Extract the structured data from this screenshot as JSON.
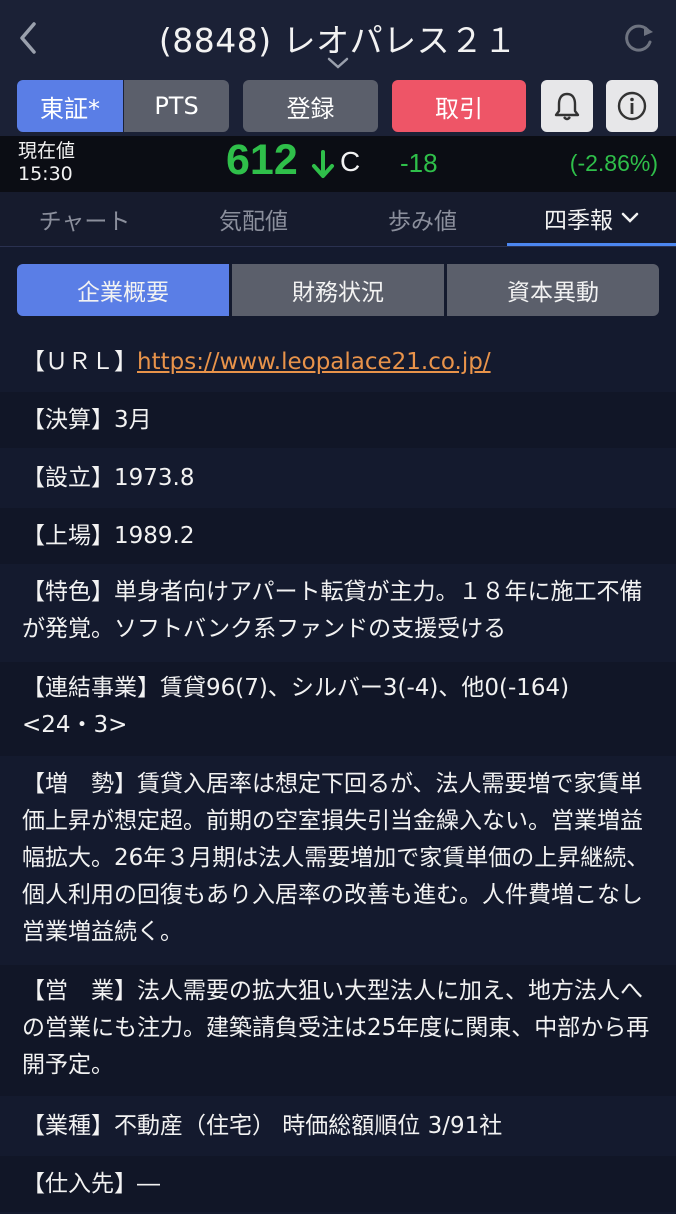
{
  "header": {
    "title": "(8848) レオパレス２１"
  },
  "buttons": {
    "tosho": "東証*",
    "pts": "PTS",
    "register": "登録",
    "trade": "取引",
    "bell_icon": "bell-icon",
    "info_icon": "info-icon"
  },
  "quote": {
    "current_label": "現在値",
    "time": "15:30",
    "price": "612",
    "status": "C",
    "change": "-18",
    "change_pct": "(-2.86%)",
    "color_down": "#2fbf4a"
  },
  "tabs": [
    {
      "label": "チャート"
    },
    {
      "label": "気配値"
    },
    {
      "label": "歩み値"
    },
    {
      "label": "四季報"
    }
  ],
  "subtabs": [
    {
      "label": "企業概要"
    },
    {
      "label": "財務状況"
    },
    {
      "label": "資本異動"
    }
  ],
  "info": {
    "url": {
      "label": "【ＵＲＬ】",
      "value": "https://www.leopalace21.co.jp/"
    },
    "settlement": {
      "label": "【決算】",
      "value": "3月"
    },
    "established": {
      "label": "【設立】",
      "value": "1973.8"
    },
    "listed": {
      "label": "【上場】",
      "value": "1989.2"
    },
    "features": {
      "label": "【特色】",
      "value": "単身者向けアパート転貸が主力。１８年に施工不備が発覚。ソフトバンク系ファンドの支援受ける"
    },
    "segments": {
      "label": "【連結事業】",
      "value": "賃貸96(7)、シルバー3(-4)、他0(-164)",
      "value2": "<24・3>"
    },
    "growth": {
      "label": "【増　勢】",
      "value": "賃貸入居率は想定下回るが、法人需要増で家賃単価上昇が想定超。前期の空室損失引当金繰入ない。営業増益幅拡大。26年３月期は法人需要増加で家賃単価の上昇継続、個人利用の回復もあり入居率の改善も進む。人件費増こなし営業増益続く。"
    },
    "sales": {
      "label": "【営　業】",
      "value": "法人需要の拡大狙い大型法人に加え、地方法人への営業にも注力。建築請負受注は25年度に関東、中部から再開予定。"
    },
    "industry": {
      "label": "【業種】",
      "value": "不動産（住宅）  時価総額順位 3/91社"
    },
    "suppliers": {
      "label": "【仕入先】",
      "value": "―"
    }
  }
}
